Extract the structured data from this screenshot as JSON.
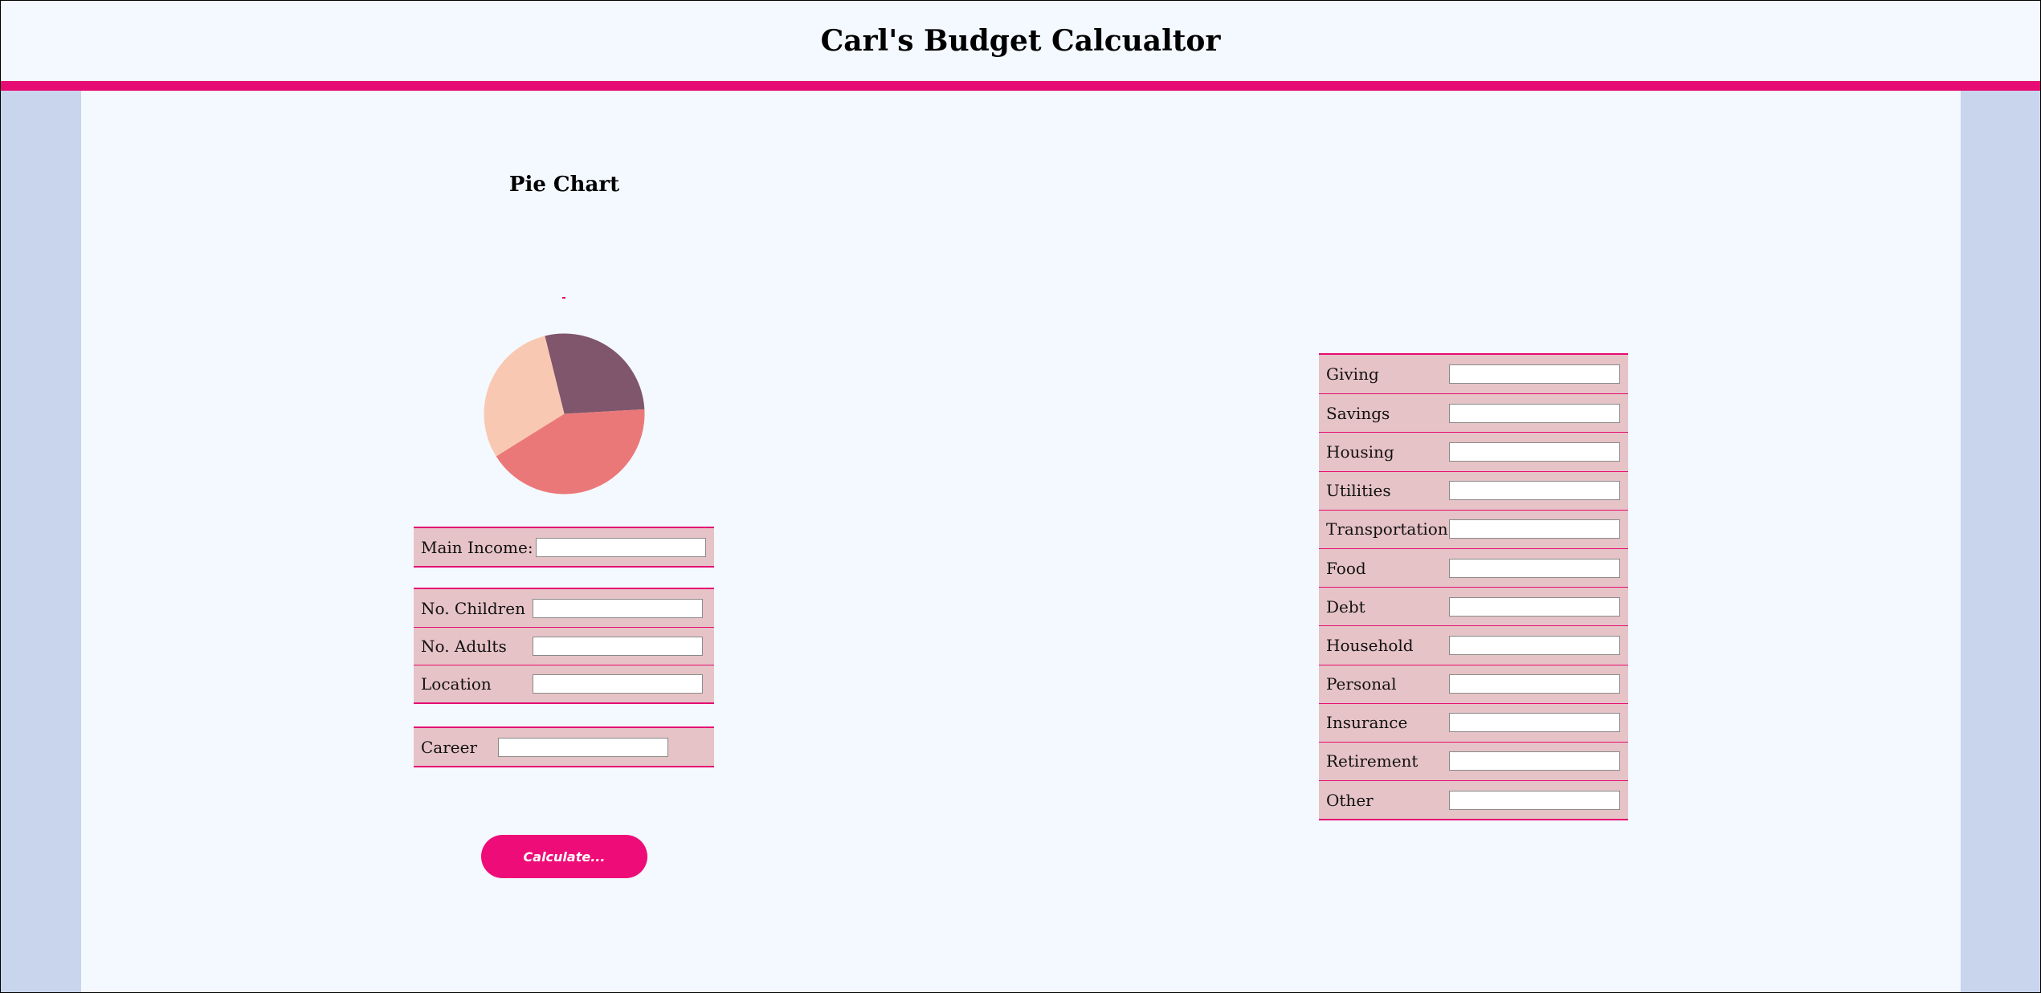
{
  "header": {
    "title": "Carl's Budget Calcualtor"
  },
  "chart": {
    "title": "Pie Chart"
  },
  "chart_data": {
    "type": "pie",
    "title": "Pie Chart",
    "values": [
      28,
      42,
      30
    ],
    "colors": [
      "#7f566b",
      "#eb7878",
      "#f9c8b2"
    ]
  },
  "income_group": {
    "main_income": {
      "label": "Main Income:",
      "value": ""
    }
  },
  "household_group": {
    "children": {
      "label": "No. Children",
      "value": ""
    },
    "adults": {
      "label": "No. Adults",
      "value": ""
    },
    "location": {
      "label": "Location",
      "value": ""
    }
  },
  "career_group": {
    "career": {
      "label": "Career",
      "value": ""
    }
  },
  "calculate_button": {
    "label": "Calculate..."
  },
  "expenses": [
    {
      "label": "Giving",
      "value": ""
    },
    {
      "label": "Savings",
      "value": ""
    },
    {
      "label": "Housing",
      "value": ""
    },
    {
      "label": "Utilities",
      "value": ""
    },
    {
      "label": "Transportation",
      "value": ""
    },
    {
      "label": "Food",
      "value": ""
    },
    {
      "label": "Debt",
      "value": ""
    },
    {
      "label": "Household",
      "value": ""
    },
    {
      "label": "Personal",
      "value": ""
    },
    {
      "label": "Insurance",
      "value": ""
    },
    {
      "label": "Retirement",
      "value": ""
    },
    {
      "label": "Other",
      "value": ""
    }
  ],
  "colors": {
    "accent": "#e60c73",
    "side": "#c9d4ed",
    "background": "#f4f9ff",
    "row": "#e6c3c6",
    "button": "#ee0d78"
  }
}
